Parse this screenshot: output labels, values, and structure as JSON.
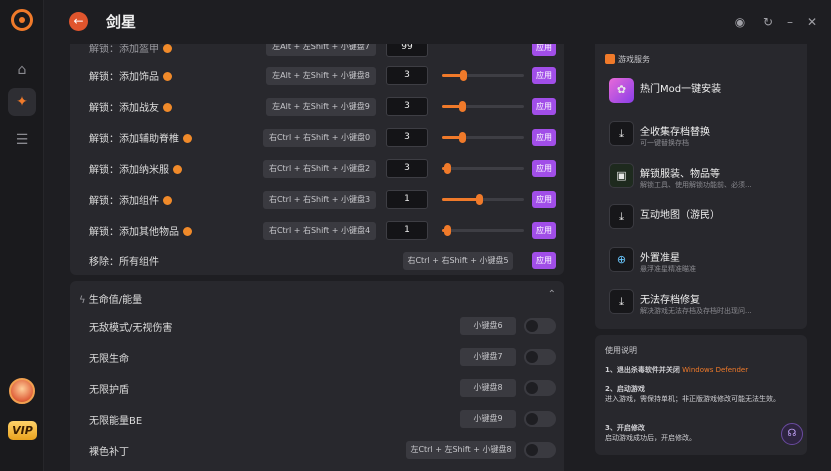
{
  "app": {
    "title": "剑星",
    "back_icon": "arrow-left-icon"
  },
  "colors": {
    "accent": "#f07a2a",
    "apply": "#a14ee8",
    "vip": "#f0b030"
  },
  "sidebar": {
    "vip_label": "VIP"
  },
  "items_panel": {
    "rows": [
      {
        "label": "解锁：添加饰品",
        "key": "左Alt + 左Shift + 小键盘8",
        "value": "3",
        "level": 0.24,
        "apply": "应用"
      },
      {
        "label": "解锁：添加战友",
        "key": "左Alt + 左Shift + 小键盘9",
        "value": "3",
        "level": 0.22,
        "apply": "应用"
      },
      {
        "label": "解锁：添加辅助脊椎",
        "key": "右Ctrl + 右Shift + 小键盘0",
        "value": "3",
        "level": 0.22,
        "apply": "应用"
      },
      {
        "label": "解锁：添加纳米服",
        "key": "右Ctrl + 右Shift + 小键盘2",
        "value": "3",
        "level": 0.02,
        "apply": "应用"
      },
      {
        "label": "解锁：添加组件",
        "key": "右Ctrl + 右Shift + 小键盘3",
        "value": "1",
        "level": 0.45,
        "apply": "应用"
      },
      {
        "label": "解锁：添加其他物品",
        "key": "右Ctrl + 右Shift + 小键盘4",
        "value": "1",
        "level": 0.02,
        "apply": "应用"
      }
    ],
    "remove_row": {
      "label": "移除：所有组件",
      "key": "右Ctrl + 右Shift + 小键盘5",
      "apply": "应用"
    }
  },
  "health_panel": {
    "title": "生命值/能量",
    "rows": [
      {
        "label": "无敌模式/无视伤害",
        "key": "小键盘6"
      },
      {
        "label": "无限生命",
        "key": "小键盘7"
      },
      {
        "label": "无限护盾",
        "key": "小键盘8"
      },
      {
        "label": "无限能量BE",
        "key": "小键盘9"
      },
      {
        "label": "裸色补丁",
        "key": "左Ctrl + 左Shift + 小键盘8"
      }
    ]
  },
  "services": {
    "title": "游戏服务",
    "items": [
      {
        "name": "热门Mod一键安装",
        "sub": "",
        "icon": "mod-icon"
      },
      {
        "name": "全收集存档替换",
        "sub": "可一键替换存档",
        "icon": "download-icon"
      },
      {
        "name": "解锁服装、物品等",
        "sub": "解锁工具、使用解锁功能前、必须...",
        "icon": "unlock-icon"
      },
      {
        "name": "互动地图（游民）",
        "sub": "",
        "icon": "map-icon"
      },
      {
        "name": "外置准星",
        "sub": "悬浮准星精准瞄准",
        "icon": "crosshair-icon"
      },
      {
        "name": "无法存档修复",
        "sub": "解决游戏无法存档及存档时出现问...",
        "icon": "repair-icon"
      }
    ]
  },
  "guide": {
    "title": "使用说明",
    "step1_title": "1、退出杀毒软件并关闭",
    "step1_highlight": "Windows Defender",
    "step2_title": "2、启动游戏",
    "step2_text": "进入游戏，需保持单机；非正版游戏修改可能无法生效。",
    "step3_title": "3、开启修改",
    "step3_text": "启动游戏成功后，开启修改。"
  }
}
